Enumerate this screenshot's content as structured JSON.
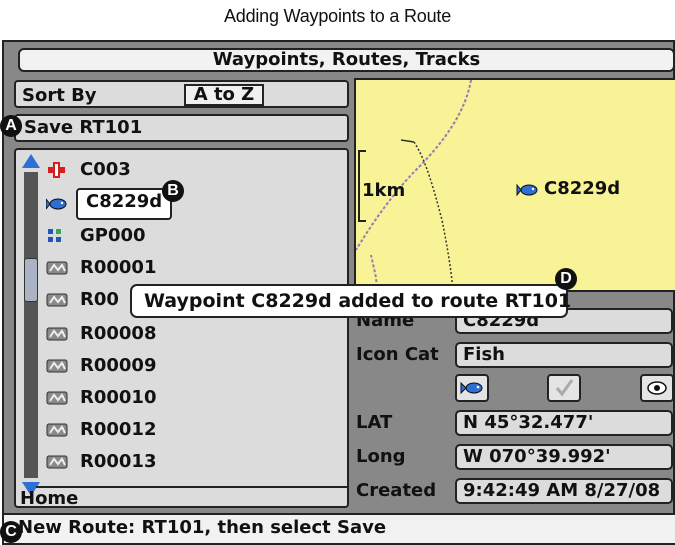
{
  "caption": "Adding Waypoints to a Route",
  "window": {
    "title": "Waypoints, Routes, Tracks"
  },
  "sort": {
    "label": "Sort By",
    "value": "A to Z"
  },
  "save_row": {
    "label": "Save RT101"
  },
  "list": {
    "items": [
      {
        "label": "C003",
        "icon": "red-cross-icon"
      },
      {
        "label": "C8229d",
        "icon": "fish-icon",
        "selected": true
      },
      {
        "label": "GP000",
        "icon": "gp-grid-icon"
      },
      {
        "label": "R00001",
        "icon": "route-icon"
      },
      {
        "label": "R00",
        "icon": "route-icon"
      },
      {
        "label": "R00008",
        "icon": "route-icon"
      },
      {
        "label": "R00009",
        "icon": "route-icon"
      },
      {
        "label": "R00010",
        "icon": "route-icon"
      },
      {
        "label": "R00012",
        "icon": "route-icon"
      },
      {
        "label": "R00013",
        "icon": "route-icon"
      }
    ],
    "footer": "Home"
  },
  "map": {
    "scale_label": "1km",
    "waypoint_label": "C8229d",
    "background_color": "#f7f396"
  },
  "details": {
    "name_label": "Name",
    "name_value": "C8229d",
    "icon_cat_label": "Icon Cat",
    "icon_cat_value": "Fish",
    "lat_label": "LAT",
    "lat_value": "N 45°32.477'",
    "long_label": "Long",
    "long_value": "W 070°39.992'",
    "created_label": "Created",
    "created_value": "9:42:49 AM 8/27/08"
  },
  "tooltip": {
    "text": "Waypoint C8229d added to route RT101"
  },
  "status": {
    "text": "New Route: RT101, then select Save"
  },
  "callouts": {
    "a": "A",
    "b": "B",
    "c": "C",
    "d": "D"
  },
  "colors": {
    "accent": "#2d6fd6",
    "map": "#f7f396",
    "panel": "#dcdcdc"
  }
}
